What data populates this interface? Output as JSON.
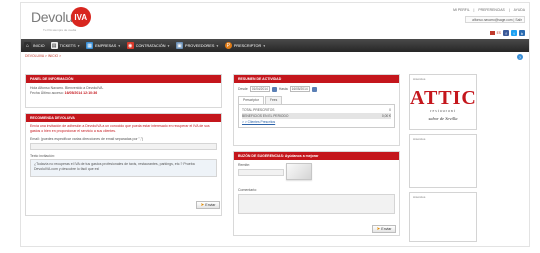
{
  "brand": {
    "name": "Devolu",
    "badge": "IVA",
    "tagline": "Tu IVA siempre de vuelta"
  },
  "top_links": [
    "MI PERFIL",
    "PREFERENCIAS",
    "AYUDA"
  ],
  "user_email": "alfonso.navarro@sage.com",
  "logout_label": "Salir",
  "lang_label": "ES",
  "social": {
    "facebook": "f",
    "twitter": "t",
    "blog": "b"
  },
  "nav": [
    {
      "label": "INICIO",
      "icon": "home-icon",
      "color": "#2f2f2f",
      "glyph": "⌂"
    },
    {
      "label": "TICKETS",
      "icon": "ticket-icon",
      "color": "#eeeeee",
      "glyph": "▤"
    },
    {
      "label": "EMPRESAS",
      "icon": "company-icon",
      "color": "#3a8fd6",
      "glyph": "▦"
    },
    {
      "label": "CONTRATACIÓN",
      "icon": "contract-icon",
      "color": "#d93a2b",
      "glyph": "◉"
    },
    {
      "label": "PROVEEDORES",
      "icon": "suppliers-icon",
      "color": "#6b8fb5",
      "glyph": "▣"
    },
    {
      "label": "PRESCRIPTOR",
      "icon": "prescriptor-icon",
      "color": "#e07b16",
      "glyph": "P"
    }
  ],
  "breadcrumb": "DEVOLUIVA > INICIO >",
  "info_panel": {
    "title": "PANEL DE INFORMACIÓN",
    "greeting": "Hola Alfonso Navarro. Bienvenido a DevoluIVA.",
    "last_access_label": "Fecha Último acceso:",
    "last_access_value": "16/05/2014 12:10:36"
  },
  "recommend_panel": {
    "title": "RECOMIENDA DEVOLUIVA",
    "intro": "Envía una invitación de adhesión a DevoluIVA a un conocido que pueda estar interesado en recuperar el IVA de sus gastos o bien en proporcionar el servicio a sus clientes.",
    "email_label": "Email: (puedes especificar varias direcciones de email separadas por \",\")",
    "invitation_label": "Texto invitación:",
    "invitation_text_1": "¿Todavía no recuperas el IVA de tus gastos profesionales de taxis, restaurantes, parkings, etc.? Prueba DevoluIVA.com y descubre lo fácil que es!",
    "send_label": "Enviar"
  },
  "activity_panel": {
    "title": "RESUMEN DE ACTIVIDAD",
    "from_label": "Desde",
    "from_value": "01/04/2014",
    "to_label": "Hasta",
    "to_value": "16/05/2014",
    "tabs": [
      "Prescriptor",
      "Fees"
    ],
    "rows": [
      {
        "label": "TOTAL PRESCRITOS",
        "value": "0"
      },
      {
        "label": "BENEFICIOS EN EL PERIODO",
        "value": "0,00 €"
      }
    ],
    "link": "> > Clientes Prescritos"
  },
  "suggestions_panel": {
    "title": "BUZÓN DE SUGERENCIAS: Ayúdanos a mejorar",
    "sender_label": "Remite:",
    "comment_label": "Comentario:",
    "send_label": "Enviar"
  },
  "ads": {
    "label": "Anuncios",
    "attic_name": "ATTIC",
    "attic_sub": "restaurant",
    "attic_tag": "sabor de Sevilla"
  }
}
